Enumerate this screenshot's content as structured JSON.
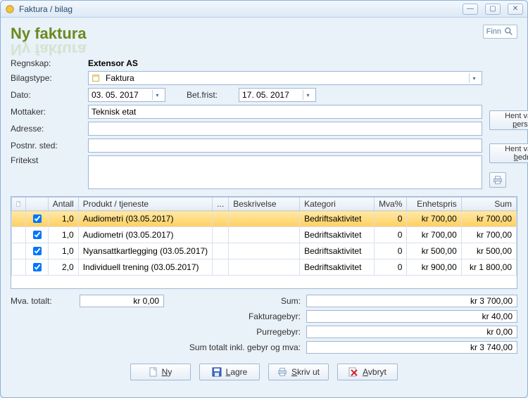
{
  "window": {
    "title": "Faktura / bilag"
  },
  "header": {
    "title": "Ny faktura",
    "finn_label": "Finn"
  },
  "form": {
    "regnskap_label": "Regnskap:",
    "regnskap_value": "Extensor AS",
    "bilagstype_label": "Bilagstype:",
    "bilagstype_value": "Faktura",
    "dato_label": "Dato:",
    "dato_value": "03. 05. 2017",
    "betfrist_label": "Bet.frist:",
    "betfrist_value": "17. 05. 2017",
    "mottaker_label": "Mottaker:",
    "mottaker_value": "Teknisk etat",
    "adresse_label": "Adresse:",
    "adresse_value": "",
    "postnr_label": "Postnr. sted:",
    "postnr_value": "",
    "fritekst_label": "Fritekst",
    "hent_person": "Hent valgte person",
    "hent_bedrift": "Hent valgte bedrift"
  },
  "grid": {
    "columns": {
      "check": "",
      "antall": "Antall",
      "produkt": "Produkt / tjeneste",
      "more": "...",
      "beskrivelse": "Beskrivelse",
      "kategori": "Kategori",
      "mva": "Mva%",
      "enhetspris": "Enhetspris",
      "sum": "Sum"
    },
    "rows": [
      {
        "checked": true,
        "selected": true,
        "antall": "1,0",
        "produkt": "Audiometri (03.05.2017)",
        "beskrivelse": "",
        "kategori": "Bedriftsaktivitet",
        "mva": "0",
        "enhetspris": "kr 700,00",
        "sum": "kr 700,00"
      },
      {
        "checked": true,
        "selected": false,
        "antall": "1,0",
        "produkt": "Audiometri (03.05.2017)",
        "beskrivelse": "",
        "kategori": "Bedriftsaktivitet",
        "mva": "0",
        "enhetspris": "kr 700,00",
        "sum": "kr 700,00"
      },
      {
        "checked": true,
        "selected": false,
        "antall": "1,0",
        "produkt": "Nyansattkartlegging (03.05.2017)",
        "beskrivelse": "",
        "kategori": "Bedriftsaktivitet",
        "mva": "0",
        "enhetspris": "kr 500,00",
        "sum": "kr 500,00"
      },
      {
        "checked": true,
        "selected": false,
        "antall": "2,0",
        "produkt": "Individuell trening (03.05.2017)",
        "beskrivelse": "",
        "kategori": "Bedriftsaktivitet",
        "mva": "0",
        "enhetspris": "kr 900,00",
        "sum": "kr 1 800,00"
      }
    ]
  },
  "summary": {
    "mva_label": "Mva. totalt:",
    "mva_value": "kr 0,00",
    "sum_label": "Sum:",
    "sum_value": "kr 3 700,00",
    "fakturagebyr_label": "Fakturagebyr:",
    "fakturagebyr_value": "kr 40,00",
    "purregebyr_label": "Purregebyr:",
    "purregebyr_value": "kr 0,00",
    "total_label": "Sum totalt inkl. gebyr og mva:",
    "total_value": "kr 3 740,00"
  },
  "footer": {
    "ny": "Ny",
    "lagre": "Lagre",
    "skrivut": "Skriv ut",
    "avbryt": "Avbryt"
  }
}
